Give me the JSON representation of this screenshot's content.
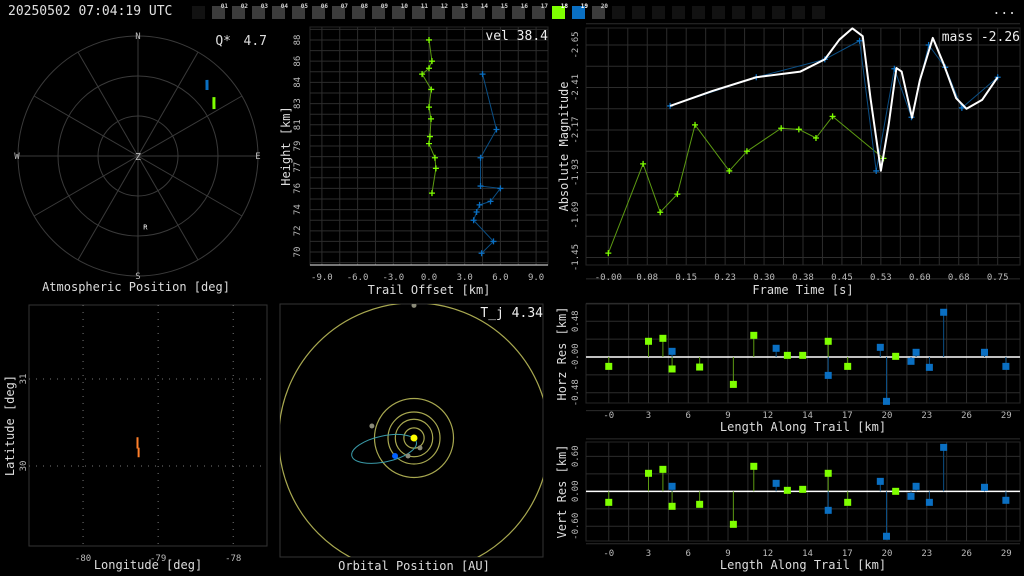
{
  "header": {
    "timestamp": "20250502 07:04:19 UTC",
    "menu_label": "...",
    "frames": [
      {
        "label": "",
        "state": "empty"
      },
      {
        "label": "01",
        "state": "normal"
      },
      {
        "label": "02",
        "state": "normal"
      },
      {
        "label": "03",
        "state": "normal"
      },
      {
        "label": "04",
        "state": "normal"
      },
      {
        "label": "05",
        "state": "normal"
      },
      {
        "label": "06",
        "state": "normal"
      },
      {
        "label": "07",
        "state": "normal"
      },
      {
        "label": "08",
        "state": "normal"
      },
      {
        "label": "09",
        "state": "normal"
      },
      {
        "label": "10",
        "state": "normal"
      },
      {
        "label": "11",
        "state": "normal"
      },
      {
        "label": "12",
        "state": "normal"
      },
      {
        "label": "13",
        "state": "normal"
      },
      {
        "label": "14",
        "state": "normal"
      },
      {
        "label": "15",
        "state": "normal"
      },
      {
        "label": "16",
        "state": "normal"
      },
      {
        "label": "17",
        "state": "normal"
      },
      {
        "label": "18",
        "state": "sel-a"
      },
      {
        "label": "19",
        "state": "sel-b"
      },
      {
        "label": "20",
        "state": "normal"
      },
      {
        "label": "",
        "state": "empty"
      },
      {
        "label": "",
        "state": "empty"
      },
      {
        "label": "",
        "state": "empty"
      },
      {
        "label": "",
        "state": "empty"
      },
      {
        "label": "",
        "state": "empty"
      },
      {
        "label": "",
        "state": "empty"
      },
      {
        "label": "",
        "state": "empty"
      },
      {
        "label": "",
        "state": "empty"
      },
      {
        "label": "",
        "state": "empty"
      },
      {
        "label": "",
        "state": "empty"
      },
      {
        "label": "",
        "state": "empty"
      }
    ]
  },
  "colors": {
    "station_a": "#7fff00",
    "station_a_line": "#5c9a12",
    "station_b": "#0a6fc2",
    "station_b_line": "#0b4f85",
    "fit": "#ffffff",
    "grid": "#2c2c2c",
    "trail": "#ff7f2a",
    "planet_orbit": "#a8a850",
    "meteoroid_orbit": "#3a9aa8",
    "sun": "#ffff00",
    "earth": "#0060ff",
    "planet": "#8a8a78"
  },
  "chart_data": [
    {
      "id": "polar",
      "type": "scatter",
      "title": "Atmospheric Position [deg]",
      "stat_label": "Q*",
      "stat_value": "4.7",
      "directions": {
        "n": "N",
        "e": "E",
        "s": "S",
        "w": "W",
        "zenith": "Z"
      },
      "rings_deg": [
        30,
        60,
        90
      ],
      "radiant": {
        "label": "R",
        "az": 174,
        "alt": 37
      },
      "series": [
        {
          "name": "station_a",
          "points": [
            {
              "az": 52.2,
              "alt": 17.9
            },
            {
              "az": 55,
              "alt": 20.5
            },
            {
              "az": 58.3,
              "alt": 23
            }
          ]
        },
        {
          "name": "station_b",
          "points": [
            {
              "az": 42.2,
              "alt": 13
            },
            {
              "az": 44,
              "alt": 15.5
            },
            {
              "az": 46.3,
              "alt": 18.4
            }
          ]
        }
      ]
    },
    {
      "id": "height",
      "type": "line",
      "xlabel": "Trail Offset [km]",
      "ylabel": "Height [km]",
      "stat": "vel 38.4",
      "xlim": [
        -10,
        10
      ],
      "ylim": [
        68.9,
        89.1
      ],
      "xticks": [
        -9,
        -6,
        -3,
        0,
        3,
        6,
        9
      ],
      "xtick_labels": [
        "-9.0",
        "-6.0",
        "-3.0",
        "0.0",
        "3.0",
        "6.0",
        "9.0"
      ],
      "yticks": [
        88,
        86.2,
        84.4,
        82.6,
        80.8,
        79,
        77.2,
        75.4,
        73.6,
        71.8,
        70
      ],
      "ytick_labels": [
        "88",
        "86",
        "84",
        "83",
        "81",
        "79",
        "77",
        "76",
        "74",
        "72",
        "70"
      ],
      "series": [
        {
          "name": "station_a",
          "x": [
            0,
            0.25,
            0,
            -0.58,
            0.19,
            0,
            0.17,
            0.08,
            0,
            0.5,
            0.58,
            0.25
          ],
          "y": [
            88,
            86.2,
            85.6,
            85.1,
            83.8,
            82.3,
            81.3,
            79.8,
            79.2,
            78,
            77.1,
            75
          ]
        },
        {
          "name": "station_b",
          "x": [
            4.5,
            5.67,
            4.33,
            4.33,
            6,
            5.17,
            4.25,
            4,
            3.75,
            5.42,
            4.42
          ],
          "y": [
            85.1,
            80.4,
            78,
            75.6,
            75.4,
            74.3,
            74,
            73.4,
            72.7,
            70.9,
            69.9
          ]
        }
      ]
    },
    {
      "id": "magnitude",
      "type": "line",
      "xlabel": "Frame Time [s]",
      "ylabel": "Absolute Magnitude",
      "stat": "mass -2.26",
      "xlim": [
        -0.043,
        0.793
      ],
      "ylim": [
        -1.408,
        -2.746
      ],
      "xticks": [
        0,
        0.075,
        0.15,
        0.225,
        0.3,
        0.375,
        0.45,
        0.525,
        0.6,
        0.675,
        0.75
      ],
      "xtick_labels": [
        "-0.00",
        "0.08",
        "0.15",
        "0.23",
        "0.30",
        "0.38",
        "0.45",
        "0.53",
        "0.60",
        "0.68",
        "0.75"
      ],
      "yticks": [
        -2.65,
        -2.41,
        -2.17,
        -1.93,
        -1.69,
        -1.45
      ],
      "ytick_labels": [
        "-2.65",
        "-2.41",
        "-2.17",
        "-1.93",
        "-1.69",
        "-1.45"
      ],
      "series": [
        {
          "name": "station_a",
          "x": [
            0,
            0.067,
            0.1,
            0.133,
            0.167,
            0.233,
            0.267,
            0.333,
            0.367,
            0.4,
            0.432,
            0.53
          ],
          "y": [
            -1.475,
            -1.979,
            -1.706,
            -1.808,
            -2.199,
            -1.939,
            -2.05,
            -2.18,
            -2.174,
            -2.125,
            -2.247,
            -2.01
          ]
        },
        {
          "name": "station_b",
          "x": [
            0.119,
            0.285,
            0.417,
            0.484,
            0.516,
            0.551,
            0.584,
            0.617,
            0.649,
            0.681,
            0.75
          ],
          "y": [
            -2.306,
            -2.468,
            -2.569,
            -2.674,
            -1.939,
            -2.516,
            -2.242,
            -2.65,
            -2.524,
            -2.295,
            -2.468
          ]
        },
        {
          "name": "fit",
          "x": [
            0.119,
            0.2,
            0.285,
            0.37,
            0.417,
            0.445,
            0.47,
            0.49,
            0.505,
            0.525,
            0.54,
            0.555,
            0.565,
            0.585,
            0.6,
            0.625,
            0.645,
            0.67,
            0.69,
            0.72,
            0.75
          ],
          "y": [
            -2.306,
            -2.39,
            -2.468,
            -2.5,
            -2.569,
            -2.68,
            -2.744,
            -2.7,
            -2.35,
            -1.94,
            -2.2,
            -2.52,
            -2.5,
            -2.24,
            -2.45,
            -2.69,
            -2.55,
            -2.35,
            -2.29,
            -2.34,
            -2.468
          ]
        }
      ]
    },
    {
      "id": "horz_res",
      "type": "scatter",
      "xlabel": "Length Along Trail [km]",
      "ylabel": "Horz Res [km]",
      "xlim": [
        -1.66,
        30
      ],
      "ylim": [
        -0.618,
        0.712
      ],
      "xticks": [
        0,
        2.9,
        5.8,
        8.7,
        11.6,
        14.5,
        17.4,
        20.3,
        23.2,
        26.1,
        29
      ],
      "xtick_labels": [
        "-0",
        "3",
        "6",
        "9",
        "12",
        "14",
        "17",
        "20",
        "23",
        "26",
        "29"
      ],
      "yticks": [
        0.48,
        0,
        -0.48
      ],
      "ytick_labels": [
        "0.48",
        "-0.00",
        "-0.48"
      ],
      "series": [
        {
          "name": "station_a",
          "x": [
            0,
            2.9,
            3.95,
            4.62,
            6.63,
            9.09,
            10.58,
            13.03,
            14.15,
            16.01,
            17.43,
            20.93
          ],
          "y": [
            -0.126,
            0.211,
            0.251,
            -0.161,
            -0.135,
            -0.368,
            0.291,
            0.022,
            0.022,
            0.211,
            -0.126,
            0.009
          ]
        },
        {
          "name": "station_b",
          "x": [
            4.62,
            12.21,
            16.01,
            19.81,
            20.26,
            22.05,
            22.42,
            23.39,
            24.43,
            27.41,
            28.97
          ],
          "y": [
            0.076,
            0.117,
            -0.247,
            0.13,
            -0.596,
            -0.058,
            0.063,
            -0.139,
            0.601,
            0.063,
            -0.126
          ]
        }
      ]
    },
    {
      "id": "vert_res",
      "type": "scatter",
      "xlabel": "Length Along Trail [km]",
      "ylabel": "Vert Res [km]",
      "xlim": [
        -1.66,
        30
      ],
      "ylim": [
        -0.852,
        0.846
      ],
      "xticks": [
        0,
        2.9,
        5.8,
        8.7,
        11.6,
        14.5,
        17.4,
        20.3,
        23.2,
        26.1,
        29
      ],
      "xtick_labels": [
        "-0",
        "3",
        "6",
        "9",
        "12",
        "14",
        "17",
        "20",
        "23",
        "26",
        "29"
      ],
      "yticks": [
        0.6,
        0,
        -0.6
      ],
      "ytick_labels": [
        "0.60",
        "0.00",
        "-0.60"
      ],
      "series": [
        {
          "name": "station_a",
          "x": [
            0,
            2.9,
            3.95,
            4.62,
            6.63,
            9.09,
            10.58,
            13.03,
            14.15,
            16.01,
            17.43,
            20.93
          ],
          "y": [
            -0.189,
            0.309,
            0.377,
            -0.257,
            -0.223,
            -0.566,
            0.429,
            0.017,
            0.034,
            0.309,
            -0.189,
            0
          ]
        },
        {
          "name": "station_b",
          "x": [
            4.62,
            12.21,
            16.01,
            19.81,
            20.26,
            22.05,
            22.42,
            23.39,
            24.43,
            27.41,
            28.97
          ],
          "y": [
            0.086,
            0.137,
            -0.326,
            0.171,
            -0.771,
            -0.086,
            0.086,
            -0.189,
            0.754,
            0.069,
            -0.154
          ]
        }
      ]
    },
    {
      "id": "map",
      "type": "line",
      "xlabel": "Longitude [deg]",
      "ylabel": "Latitude [deg]",
      "xlim": [
        -80.72,
        -77.55
      ],
      "ylim": [
        29.08,
        31.85
      ],
      "xticks": [
        -80,
        -79,
        -78
      ],
      "xtick_labels": [
        "-80",
        "-79",
        "-78"
      ],
      "yticks": [
        30,
        31
      ],
      "ytick_labels": [
        "30",
        "31"
      ],
      "series": [
        {
          "name": "trail_a",
          "x": [
            -79.275,
            -79.275
          ],
          "y": [
            30.33,
            30.2
          ]
        },
        {
          "name": "trail_b",
          "x": [
            -79.26,
            -79.26
          ],
          "y": [
            30.21,
            30.1
          ]
        }
      ]
    },
    {
      "id": "orbit",
      "type": "scatter",
      "title": "Orbital Position [AU]",
      "stat": "T_j 4.34",
      "planet_orbits_au": [
        0.39,
        0.72,
        1.0,
        1.52,
        5.2
      ],
      "planets": [
        {
          "name": "mercury",
          "x": 0.23,
          "y": -0.38
        },
        {
          "name": "venus",
          "x": -0.23,
          "y": -0.69
        },
        {
          "name": "mars",
          "x": -1.62,
          "y": 0.46
        },
        {
          "name": "jupiter",
          "x": 0,
          "y": 5.1
        }
      ],
      "earth": {
        "x": -0.73,
        "y": -0.69
      },
      "meteoroid_orbit": {
        "cx": -1.15,
        "cy": -0.42,
        "a": 1.27,
        "b": 0.5,
        "tilt_deg": 12
      }
    }
  ]
}
